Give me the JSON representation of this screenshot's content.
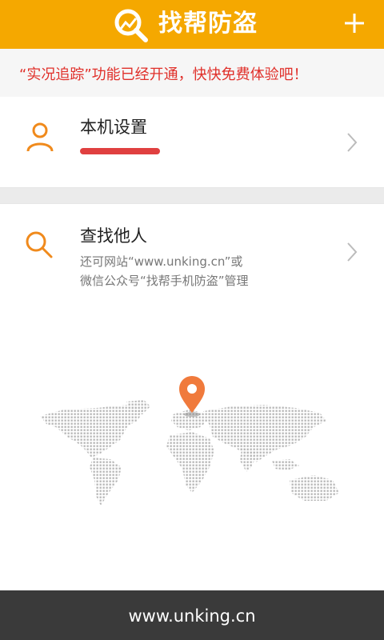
{
  "header": {
    "title": "找帮防盗",
    "logo_icon": "search-location-icon",
    "add_icon": "plus-icon",
    "color": "#f5a800"
  },
  "notice": {
    "text": "“实况追踪”功能已经开通，快快免费体验吧！",
    "color": "#e0302a"
  },
  "cards": [
    {
      "title": "本机设置",
      "icon": "user-icon"
    },
    {
      "title": "查找他人",
      "icon": "search-icon",
      "desc_line1": "还可网站“www.unking.cn”或",
      "desc_line2": "微信公众号“找帮手机防盗”管理"
    }
  ],
  "map": {
    "pin_color": "#f07a3c"
  },
  "footer": {
    "text": "www.unking.cn"
  }
}
